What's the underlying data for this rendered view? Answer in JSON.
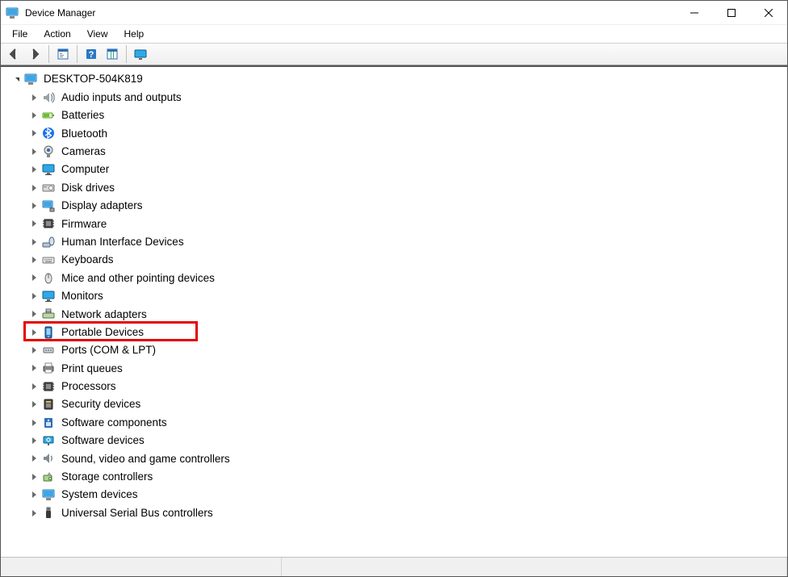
{
  "window": {
    "title": "Device Manager"
  },
  "menubar": {
    "file": "File",
    "action": "Action",
    "view": "View",
    "help": "Help"
  },
  "toolbar": {
    "back": "back",
    "forward": "forward",
    "show_hide": "show-hide",
    "help": "help",
    "scan": "scan",
    "show_hidden": "show-hidden"
  },
  "tree": {
    "root": "DESKTOP-504K819",
    "children": [
      {
        "key": "audio",
        "label": "Audio inputs and outputs",
        "icon": "speaker-icon"
      },
      {
        "key": "batteries",
        "label": "Batteries",
        "icon": "battery-icon"
      },
      {
        "key": "bluetooth",
        "label": "Bluetooth",
        "icon": "bluetooth-icon"
      },
      {
        "key": "cameras",
        "label": "Cameras",
        "icon": "camera-icon"
      },
      {
        "key": "computer",
        "label": "Computer",
        "icon": "monitor-icon"
      },
      {
        "key": "disk",
        "label": "Disk drives",
        "icon": "disk-icon"
      },
      {
        "key": "display",
        "label": "Display adapters",
        "icon": "display-adapter-icon"
      },
      {
        "key": "firmware",
        "label": "Firmware",
        "icon": "chip-icon"
      },
      {
        "key": "hid",
        "label": "Human Interface Devices",
        "icon": "hid-icon"
      },
      {
        "key": "keyboards",
        "label": "Keyboards",
        "icon": "keyboard-icon"
      },
      {
        "key": "mice",
        "label": "Mice and other pointing devices",
        "icon": "mouse-icon"
      },
      {
        "key": "monitors",
        "label": "Monitors",
        "icon": "monitor-icon"
      },
      {
        "key": "network",
        "label": "Network adapters",
        "icon": "network-icon"
      },
      {
        "key": "portable",
        "label": "Portable Devices",
        "icon": "portable-icon",
        "highlight": true
      },
      {
        "key": "ports",
        "label": "Ports (COM & LPT)",
        "icon": "port-icon"
      },
      {
        "key": "printq",
        "label": "Print queues",
        "icon": "printer-icon"
      },
      {
        "key": "processors",
        "label": "Processors",
        "icon": "cpu-icon"
      },
      {
        "key": "securitydev",
        "label": "Security devices",
        "icon": "security-icon"
      },
      {
        "key": "softcomp",
        "label": "Software components",
        "icon": "software-comp-icon"
      },
      {
        "key": "softdev",
        "label": "Software devices",
        "icon": "software-dev-icon"
      },
      {
        "key": "sound",
        "label": "Sound, video and game controllers",
        "icon": "sound-icon"
      },
      {
        "key": "storage",
        "label": "Storage controllers",
        "icon": "storage-icon"
      },
      {
        "key": "system",
        "label": "System devices",
        "icon": "system-icon"
      },
      {
        "key": "usb",
        "label": "Universal Serial Bus controllers",
        "icon": "usb-icon"
      }
    ]
  }
}
